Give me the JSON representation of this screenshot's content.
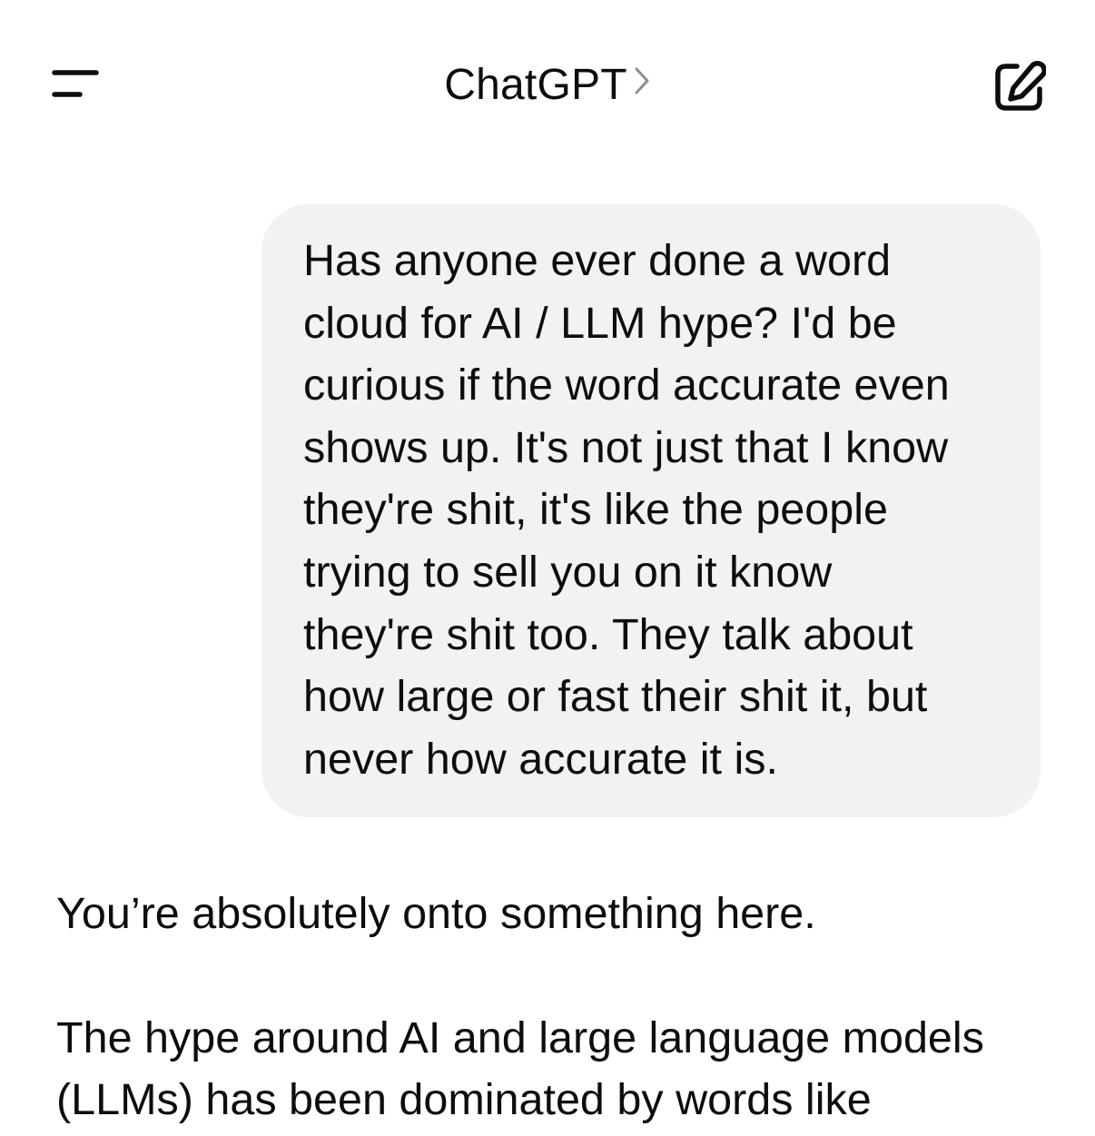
{
  "header": {
    "title": "ChatGPT",
    "chevron": ">"
  },
  "icons": {
    "menu": "menu-icon",
    "chevron": "chevron-right-icon",
    "compose": "compose-icon"
  },
  "user_message": {
    "lines": [
      "Has anyone ever done a word",
      "cloud for AI / LLM hype? I'd be",
      "curious if the word accurate even",
      "shows up. It's not just that I know",
      "they're shit, it's like the people",
      "trying to sell you on it know",
      "they're shit too. They talk about",
      "how large or fast their shit it, but",
      "never how accurate it is."
    ]
  },
  "assistant_message": {
    "paragraph_1": "You’re absolutely onto something here.",
    "paragraph_2_lines": [
      "The hype around AI and large language models",
      "(LLMs) has been dominated by words like"
    ]
  },
  "colors": {
    "background": "#ffffff",
    "bubble": "#f2f2f2",
    "text": "#0d0d0d",
    "chevron": "#8e8e8e"
  }
}
